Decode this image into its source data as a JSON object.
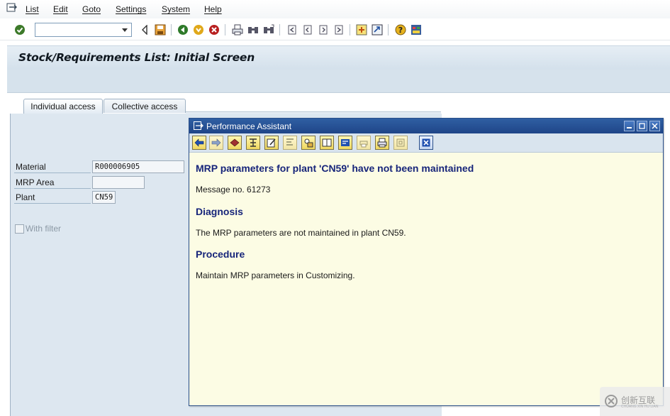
{
  "menubar": {
    "items": [
      "List",
      "Edit",
      "Goto",
      "Settings",
      "System",
      "Help"
    ]
  },
  "toolbar": {
    "command_value": "",
    "icons": [
      "enter-icon",
      "back-arrow-icon",
      "save-icon",
      "back-icon",
      "exit-icon",
      "cancel-icon",
      "print-icon",
      "find-icon",
      "find-next-icon",
      "first-page-icon",
      "previous-page-icon",
      "next-page-icon",
      "last-page-icon",
      "create-session-icon",
      "shortcut-icon",
      "help-icon",
      "customize-layout-icon"
    ]
  },
  "screen": {
    "title": "Stock/Requirements List: Initial Screen"
  },
  "tabs": [
    {
      "label": "Individual access",
      "active": true
    },
    {
      "label": "Collective access",
      "active": false
    }
  ],
  "form": {
    "material_label": "Material",
    "material_value": "R000006905",
    "mrp_area_label": "MRP Area",
    "mrp_area_value": "",
    "plant_label": "Plant",
    "plant_value": "CN59",
    "with_filter_label": "With filter",
    "with_filter_checked": false
  },
  "assistant": {
    "window_title": "Performance Assistant",
    "heading": "MRP parameters for plant 'CN59' have not been maintained",
    "message_no": "Message no. 61273",
    "diagnosis_title": "Diagnosis",
    "diagnosis_text": "The MRP parameters are not maintained in plant CN59.",
    "procedure_title": "Procedure",
    "procedure_text": "Maintain MRP parameters in Customizing.",
    "toolbar_icons": [
      "back-icon",
      "forward-icon",
      "technical-info-icon",
      "structure-icon",
      "edit-icon",
      "tooltip-icon",
      "settings-icon",
      "book-icon",
      "document-icon",
      "print-preview-icon",
      "print-icon",
      "save-local-icon",
      "close-icon"
    ]
  },
  "watermark": {
    "text": "创新互联",
    "sub": "CHUANG XIN HU LIAN"
  },
  "colors": {
    "heading_blue": "#17257a",
    "title_blue": "#1f4588",
    "help_background": "#fcfce4",
    "panel_blue": "#dde7f0"
  }
}
